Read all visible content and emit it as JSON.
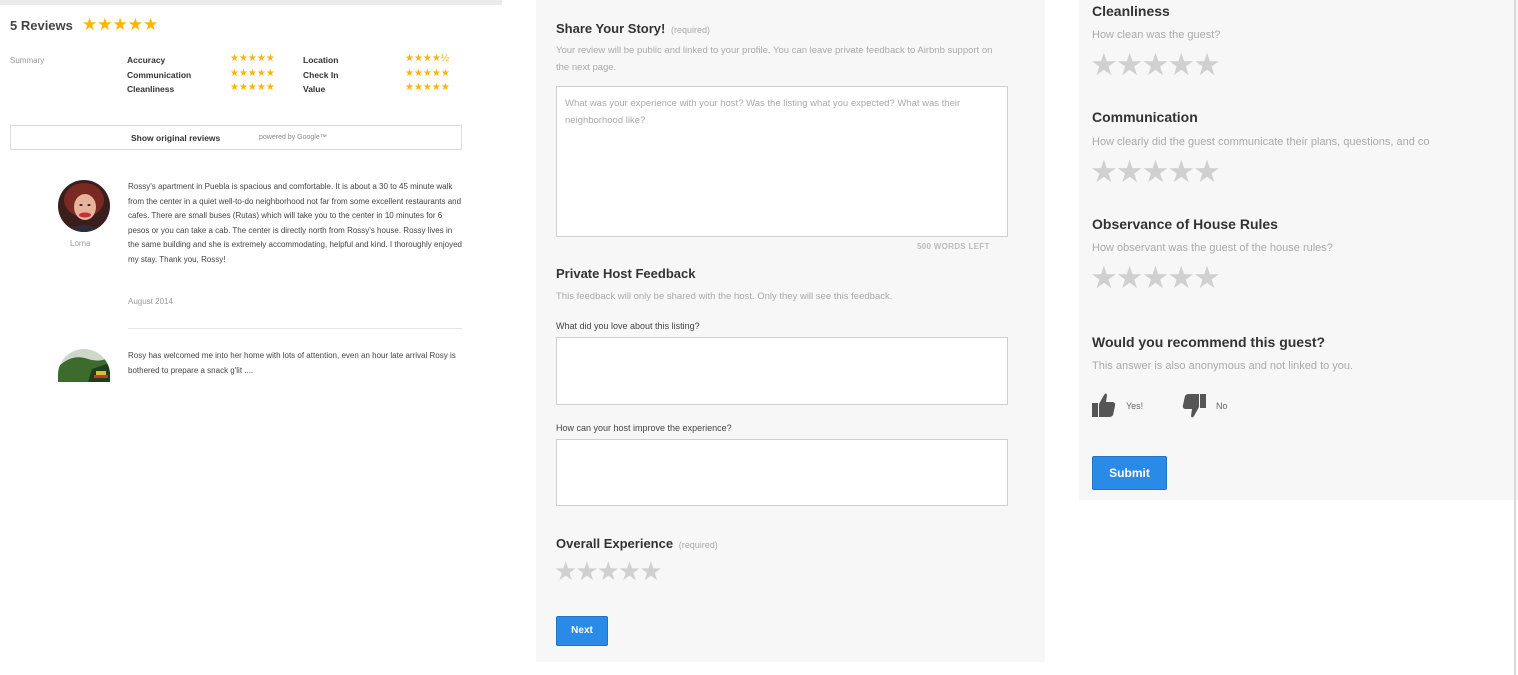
{
  "reviews_panel": {
    "heading": "5 Reviews",
    "heading_stars": "★★★★★",
    "summary_label": "Summary",
    "categories": [
      {
        "label": "Accuracy",
        "stars": "★★★★★"
      },
      {
        "label": "Communication",
        "stars": "★★★★★"
      },
      {
        "label": "Cleanliness",
        "stars": "★★★★★"
      },
      {
        "label": "Location",
        "stars": "★★★★½"
      },
      {
        "label": "Check In",
        "stars": "★★★★★"
      },
      {
        "label": "Value",
        "stars": "★★★★★"
      }
    ],
    "show_original_label": "Show original reviews",
    "powered_by": "powered by Google™",
    "reviews": [
      {
        "author": "Lorna",
        "text": "Rossy's apartment in Puebla is spacious and comfortable. It is about a 30 to 45 minute walk from the center in a quiet well-to-do neighborhood not far from some excellent restaurants and cafes. There are small buses (Rutas) which will take you to the center in 10 minutes for 6 pesos or you can take a cab. The center is directly north from Rossy's house. Rossy lives in the same building and she is extremely accommodating, helpful and kind. I thoroughly enjoyed my stay. Thank you, Rossy!",
        "date": "August 2014"
      },
      {
        "author": "",
        "text": "Rosy has welcomed me into her home with lots of attention, even an hour late arrival Rosy is bothered to prepare a snack g'lit ....",
        "date": ""
      }
    ]
  },
  "story_panel": {
    "title": "Share Your Story!",
    "title_required": "(required)",
    "intro": "Your review will be public and linked to your profile. You can leave private feedback to Airbnb support on the next page.",
    "story_placeholder": "What was your experience with your host? Was the listing what you expected? What was their neighborhood like?",
    "words_left": "500 WORDS LEFT",
    "private_title": "Private Host Feedback",
    "private_intro": "This feedback will only be shared with the host. Only they will see this feedback.",
    "love_label": "What did you love about this listing?",
    "improve_label": "How can your host improve the experience?",
    "overall_title": "Overall Experience",
    "overall_required": "(required)",
    "overall_stars": "★★★★★",
    "next_label": "Next"
  },
  "guest_panel": {
    "questions": [
      {
        "title": "Cleanliness",
        "sub": "How clean was the guest?",
        "stars": "★★★★★"
      },
      {
        "title": "Communication",
        "sub": "How clearly did the guest communicate their plans, questions, and co",
        "stars": "★★★★★"
      },
      {
        "title": "Observance of House Rules",
        "sub": "How observant was the guest of the house rules?",
        "stars": "★★★★★"
      }
    ],
    "recommend_title": "Would you recommend this guest?",
    "recommend_sub": "This answer is also anonymous and not linked to you.",
    "yes_label": "Yes!",
    "no_label": "No",
    "submit_label": "Submit"
  },
  "colors": {
    "star_gold": "#ffb400",
    "star_empty": "#d0d0d0",
    "button_blue": "#2a8ae8",
    "panel_bg": "#f7f7f7"
  },
  "icons": [
    "thumbs-up-icon",
    "thumbs-down-icon",
    "avatar-photo"
  ]
}
